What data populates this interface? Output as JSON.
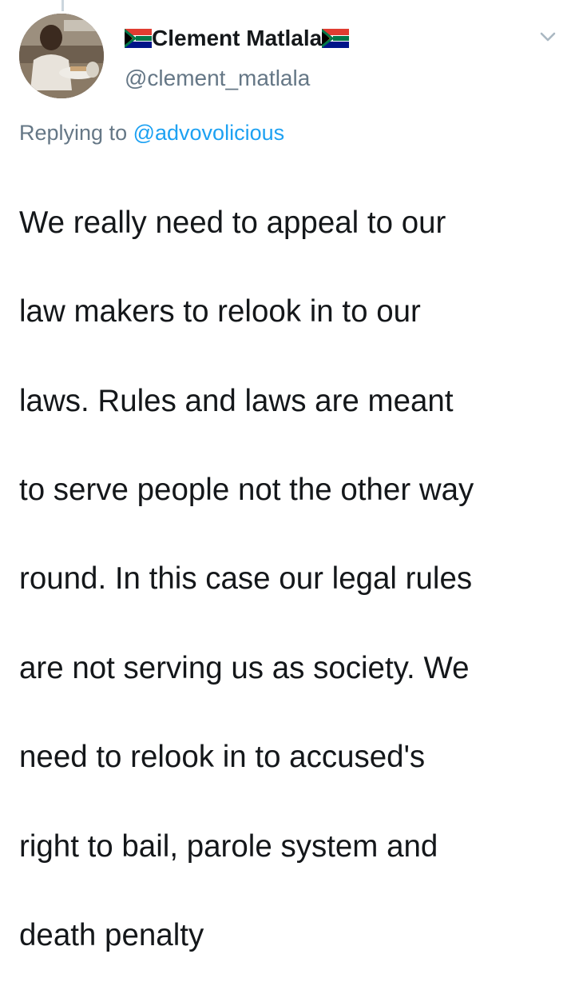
{
  "tweet": {
    "author": {
      "display_name": "Clement Matlala",
      "handle": "@clement_matlala",
      "avatar_icon": "profile-photo",
      "name_emoji_icon": "south-africa-flag-icon"
    },
    "reply": {
      "prefix": "Replying to ",
      "mention": "@advovolicious"
    },
    "text_lines": [
      "We really need to appeal to our",
      "law makers to relook in to our",
      "laws. Rules and laws are meant",
      "to serve people not the other way",
      "round. In this case our legal rules",
      "are not serving us as society. We",
      "need to relook in to accused's",
      "right to bail, parole system and",
      "death penalty"
    ],
    "menu_icon": "chevron-down-icon"
  },
  "colors": {
    "text_primary": "#14171a",
    "text_secondary": "#657786",
    "link": "#1da1f2",
    "chevron": "#aab8c2"
  }
}
